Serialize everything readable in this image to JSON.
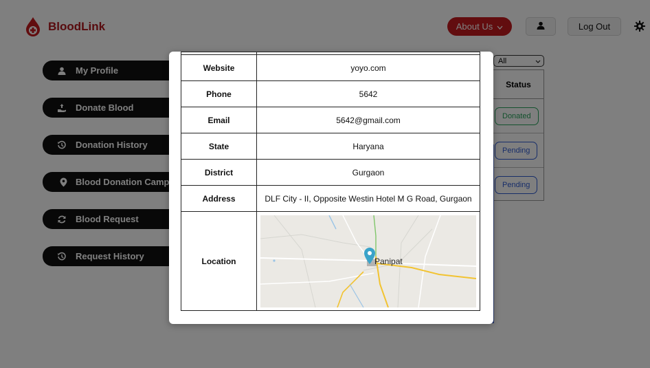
{
  "brand": {
    "name": "BloodLink"
  },
  "header": {
    "about_label": "About Us",
    "logout_label": "Log Out"
  },
  "sidebar": {
    "items": [
      {
        "label": "My Profile",
        "icon": "user-icon"
      },
      {
        "label": "Donate Blood",
        "icon": "donate-hand-icon"
      },
      {
        "label": "Donation History",
        "icon": "history-icon"
      },
      {
        "label": "Blood Donation Camps",
        "icon": "location-pin-icon"
      },
      {
        "label": "Blood Request",
        "icon": "refresh-icon"
      },
      {
        "label": "Request History",
        "icon": "history-icon"
      }
    ]
  },
  "history": {
    "filter_value": "All",
    "status_header": "Status",
    "statuses": [
      "Donated",
      "Pending",
      "Pending"
    ]
  },
  "modal": {
    "rows": [
      {
        "key": "Website",
        "value": "yoyo.com"
      },
      {
        "key": "Phone",
        "value": "5642"
      },
      {
        "key": "Email",
        "value": "5642@gmail.com"
      },
      {
        "key": "State",
        "value": "Haryana"
      },
      {
        "key": "District",
        "value": "Gurgaon"
      },
      {
        "key": "Address",
        "value": "DLF City - II, Opposite Westin Hotel M G Road, Gurgaon"
      }
    ],
    "location_label": "Location",
    "map_place": "Panipat"
  },
  "colors": {
    "brand_red": "#c41a1e",
    "donated_green": "#26a35a",
    "pending_blue": "#2f5bd3"
  }
}
